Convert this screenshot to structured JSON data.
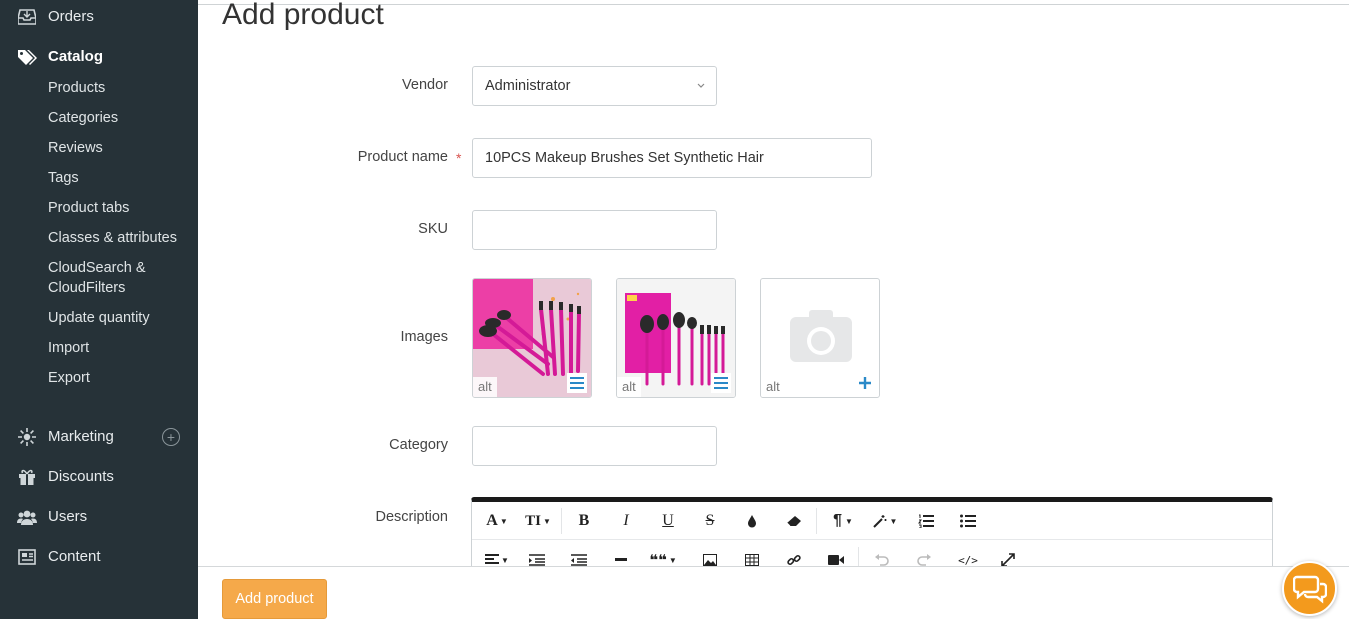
{
  "sidebar": {
    "orders": "Orders",
    "catalog": "Catalog",
    "catalog_items": [
      "Products",
      "Categories",
      "Reviews",
      "Tags",
      "Product tabs",
      "Classes & attributes",
      "CloudSearch &",
      "CloudFilters",
      "Update quantity",
      "Import",
      "Export"
    ],
    "marketing": "Marketing",
    "discounts": "Discounts",
    "users": "Users",
    "content": "Content"
  },
  "page": {
    "title": "Add product"
  },
  "form": {
    "vendor_label": "Vendor",
    "vendor_value": "Administrator",
    "product_name_label": "Product name",
    "required_mark": "*",
    "product_name_value": "10PCS Makeup Brushes Set Synthetic Hair",
    "sku_label": "SKU",
    "sku_value": "",
    "images_label": "Images",
    "image_alt": "alt",
    "category_label": "Category",
    "category_value": "",
    "description_label": "Description"
  },
  "editor_toolbar": {
    "font": "A",
    "font_size": "TI",
    "bold": "B",
    "italic": "I",
    "underline": "U",
    "strike": "S",
    "paragraph": "¶",
    "quote": "❝❝",
    "code": "</>"
  },
  "footer": {
    "add_button": "Add product"
  },
  "colors": {
    "sidebar_bg": "#263238",
    "accent": "#f5a94a",
    "chat": "#f39a1d",
    "link_icon": "#2a89c8"
  }
}
